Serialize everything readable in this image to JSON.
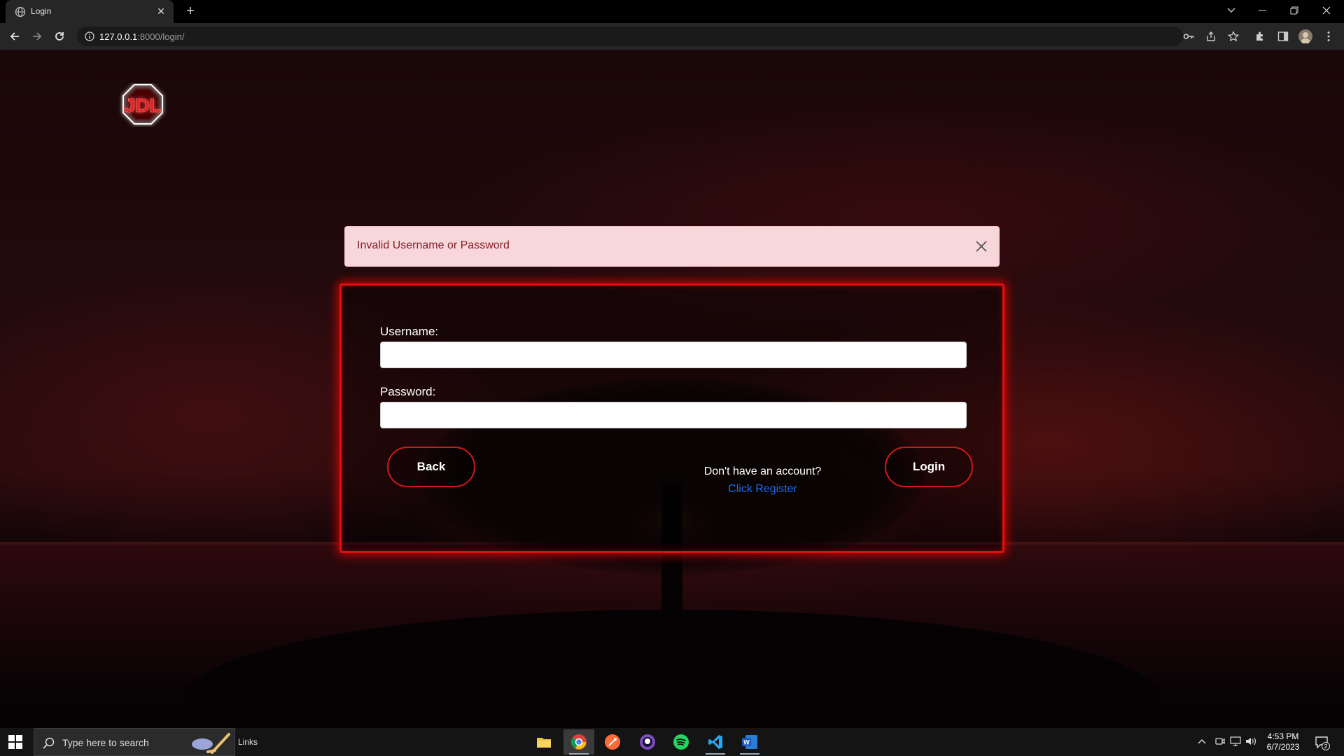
{
  "browser": {
    "tab_title": "Login",
    "url_host": "127.0.0.1",
    "url_rest": ":8000/login/"
  },
  "page": {
    "logo_text": "JDL",
    "alert_message": "Invalid Username or Password",
    "username_label": "Username:",
    "username_value": "",
    "password_label": "Password:",
    "password_value": "",
    "back_label": "Back",
    "login_label": "Login",
    "register_question": "Don't have an account?",
    "register_link": "Click Register"
  },
  "taskbar": {
    "search_placeholder": "Type here to search",
    "links_label": "Links",
    "time": "4:53 PM",
    "date": "6/7/2023",
    "notification_count": "2"
  },
  "colors": {
    "accent_red": "#e01010",
    "alert_bg": "#f8d7da",
    "alert_text": "#842029",
    "link_blue": "#1c6bf2"
  }
}
